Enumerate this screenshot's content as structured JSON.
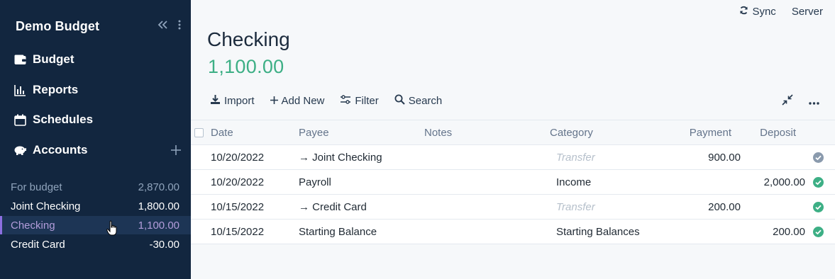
{
  "sidebar": {
    "title": "Demo Budget",
    "nav": [
      {
        "label": "Budget",
        "icon": "wallet-icon"
      },
      {
        "label": "Reports",
        "icon": "bar-chart-icon"
      },
      {
        "label": "Schedules",
        "icon": "calendar-icon"
      },
      {
        "label": "Accounts",
        "icon": "piggy-bank-icon"
      }
    ],
    "accounts": [
      {
        "name": "For budget",
        "balance": "2,870.00"
      },
      {
        "name": "Joint Checking",
        "balance": "1,800.00"
      },
      {
        "name": "Checking",
        "balance": "1,100.00"
      },
      {
        "name": "Credit Card",
        "balance": "-30.00"
      }
    ]
  },
  "topbar": {
    "sync_label": "Sync",
    "server_label": "Server"
  },
  "account": {
    "title": "Checking",
    "balance": "1,100.00"
  },
  "toolbar": {
    "import_label": "Import",
    "add_new_label": "Add New",
    "filter_label": "Filter",
    "search_label": "Search"
  },
  "table": {
    "headers": {
      "date": "Date",
      "payee": "Payee",
      "notes": "Notes",
      "category": "Category",
      "payment": "Payment",
      "deposit": "Deposit"
    },
    "rows": [
      {
        "date": "10/20/2022",
        "payee": "→ Joint Checking",
        "notes": "",
        "category": "Transfer",
        "payment": "900.00",
        "deposit": "",
        "status": "pending"
      },
      {
        "date": "10/20/2022",
        "payee": "Payroll",
        "notes": "",
        "category": "Income",
        "payment": "",
        "deposit": "2,000.00",
        "status": "cleared"
      },
      {
        "date": "10/15/2022",
        "payee": "→ Credit Card",
        "notes": "",
        "category": "Transfer",
        "payment": "200.00",
        "deposit": "",
        "status": "cleared"
      },
      {
        "date": "10/15/2022",
        "payee": "Starting Balance",
        "notes": "",
        "category": "Starting Balances",
        "payment": "",
        "deposit": "200.00",
        "status": "cleared"
      }
    ]
  },
  "colors": {
    "sidebar_bg": "#12263f",
    "accent_purple": "#8c6fe0",
    "balance_green": "#3daf85",
    "cleared_green": "#3daf85",
    "pending_gray": "#8a9aad"
  }
}
